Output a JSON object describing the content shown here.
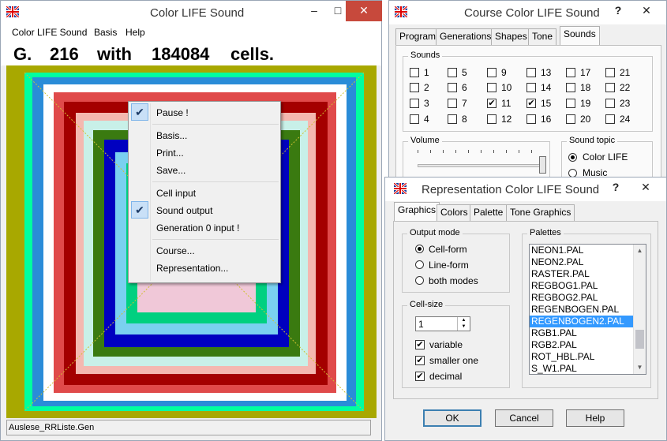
{
  "main_window": {
    "title": "Color LIFE Sound",
    "menu": [
      "Color LIFE Sound",
      "Basis",
      "Help"
    ],
    "gen_label": "G.",
    "gen_number": "216",
    "gen_with": "with",
    "cell_count": "184084",
    "cells_label": "cells.",
    "status_file": "Auslese_RRListe.Gen",
    "minimize": "–",
    "maximize": "□",
    "close": "✕"
  },
  "context_menu": {
    "items": [
      {
        "label": "Pause !",
        "checked": true
      },
      {
        "label": "Basis...",
        "checked": false
      },
      {
        "label": "Print...",
        "checked": false
      },
      {
        "label": "Save...",
        "checked": false
      },
      {
        "label": "Cell input",
        "checked": false
      },
      {
        "label": "Sound output",
        "checked": true
      },
      {
        "label": "Generation 0 input !",
        "checked": false
      },
      {
        "label": "Course...",
        "checked": false
      },
      {
        "label": "Representation...",
        "checked": false
      }
    ]
  },
  "course_window": {
    "title": "Course Color LIFE Sound",
    "help": "?",
    "close": "✕",
    "tabs": [
      "Program",
      "Generations",
      "Shapes",
      "Tone",
      "Sounds"
    ],
    "active_tab": "Sounds",
    "sounds_group": "Sounds",
    "sounds": [
      {
        "n": "1",
        "checked": false
      },
      {
        "n": "2",
        "checked": false
      },
      {
        "n": "3",
        "checked": false
      },
      {
        "n": "4",
        "checked": false
      },
      {
        "n": "5",
        "checked": false
      },
      {
        "n": "6",
        "checked": false
      },
      {
        "n": "7",
        "checked": false
      },
      {
        "n": "8",
        "checked": false
      },
      {
        "n": "9",
        "checked": false
      },
      {
        "n": "10",
        "checked": false
      },
      {
        "n": "11",
        "checked": true
      },
      {
        "n": "12",
        "checked": false
      },
      {
        "n": "13",
        "checked": false
      },
      {
        "n": "14",
        "checked": false
      },
      {
        "n": "15",
        "checked": true
      },
      {
        "n": "16",
        "checked": false
      },
      {
        "n": "17",
        "checked": false
      },
      {
        "n": "18",
        "checked": false
      },
      {
        "n": "19",
        "checked": false
      },
      {
        "n": "20",
        "checked": false
      },
      {
        "n": "21",
        "checked": false
      },
      {
        "n": "22",
        "checked": false
      },
      {
        "n": "23",
        "checked": false
      },
      {
        "n": "24",
        "checked": false
      }
    ],
    "volume_group": "Volume",
    "sound_topic_group": "Sound topic",
    "sound_topic_options": [
      "Color LIFE",
      "Music"
    ],
    "sound_topic_selected": "Color LIFE"
  },
  "repr_window": {
    "title": "Representation Color LIFE Sound",
    "help": "?",
    "close": "✕",
    "tabs": [
      "Graphics",
      "Colors",
      "Palette",
      "Tone Graphics"
    ],
    "active_tab": "Graphics",
    "output_mode_group": "Output mode",
    "output_modes": [
      "Cell-form",
      "Line-form",
      "both modes"
    ],
    "output_mode_selected": "Cell-form",
    "cell_size_group": "Cell-size",
    "cell_size_value": "1",
    "cell_options": [
      {
        "label": "variable",
        "checked": true
      },
      {
        "label": "smaller one",
        "checked": true
      },
      {
        "label": "decimal",
        "checked": true
      }
    ],
    "palettes_group": "Palettes",
    "palettes": [
      "NEON1.PAL",
      "NEON2.PAL",
      "RASTER.PAL",
      "REGBOG1.PAL",
      "REGBOG2.PAL",
      "REGENBOGEN.PAL",
      "REGENBOGEN2.PAL",
      "RGB1.PAL",
      "RGB2.PAL",
      "ROT_HBL.PAL",
      "S_W1.PAL"
    ],
    "palette_selected": "REGENBOGEN2.PAL",
    "ok_label": "OK",
    "cancel_label": "Cancel",
    "help_label": "Help"
  },
  "colors": {
    "accent": "#3399ff",
    "close_red": "#c7493c",
    "canvas_olive": "#a8a800"
  }
}
